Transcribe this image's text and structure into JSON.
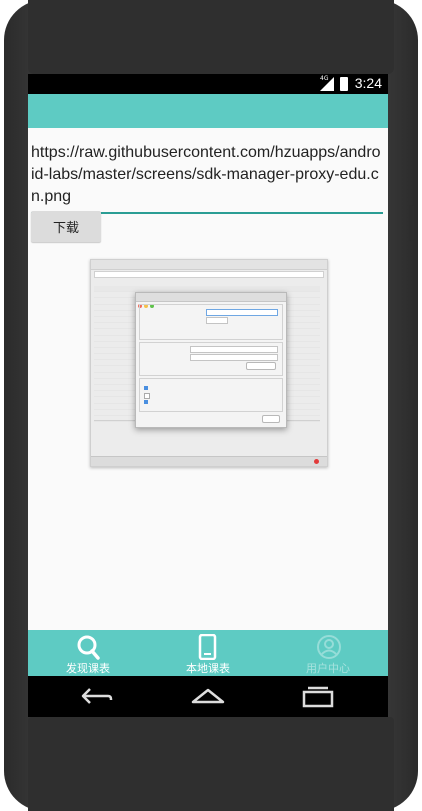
{
  "status_bar": {
    "time": "3:24",
    "network": "4G"
  },
  "url_field": {
    "value": "https://raw.githubusercontent.com/hzuapps/android-labs/master/screens/sdk-manager-proxy-edu.cn.png"
  },
  "download_button": {
    "label": "下载"
  },
  "bottom_nav": [
    {
      "label": "发现课表",
      "icon": "search-icon",
      "active": true
    },
    {
      "label": "本地课表",
      "icon": "phone-icon",
      "active": true
    },
    {
      "label": "用户中心",
      "icon": "user-icon",
      "active": false
    }
  ],
  "colors": {
    "accent": "#5ecbc3",
    "underline": "#2a9d94"
  }
}
